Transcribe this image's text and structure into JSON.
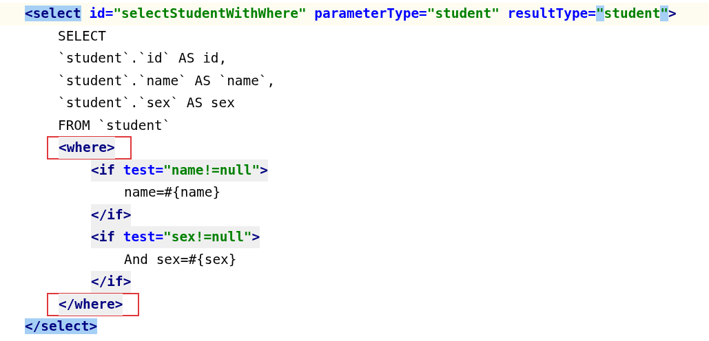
{
  "editor": {
    "lines": [
      {
        "current": true,
        "boxed": false,
        "tag_line": false,
        "tokens": [
          {
            "kind": "tag",
            "text": "<select",
            "highlighted": true
          },
          {
            "kind": "attr",
            "text": " id="
          },
          {
            "kind": "string",
            "text": "\"selectStudentWithWhere\""
          },
          {
            "kind": "attr",
            "text": " parameterType="
          },
          {
            "kind": "string",
            "text": "\"student\""
          },
          {
            "kind": "attr",
            "text": " resultType="
          },
          {
            "kind": "string",
            "text": "\"",
            "highlighted": true
          },
          {
            "kind": "string",
            "text": "student"
          },
          {
            "kind": "string",
            "text": "\"",
            "highlighted": true
          },
          {
            "kind": "tag",
            "text": ">"
          }
        ],
        "children": [
          {
            "current": false,
            "boxed": false,
            "tag_line": false,
            "tokens": [
              {
                "kind": "text",
                "text": "SELECT"
              }
            ]
          },
          {
            "current": false,
            "boxed": false,
            "tag_line": false,
            "tokens": [
              {
                "kind": "text",
                "text": "`student`.`id` AS id,"
              }
            ]
          },
          {
            "current": false,
            "boxed": false,
            "tag_line": false,
            "tokens": [
              {
                "kind": "text",
                "text": "`student`.`name` AS `name`,"
              }
            ]
          },
          {
            "current": false,
            "boxed": false,
            "tag_line": false,
            "tokens": [
              {
                "kind": "text",
                "text": "`student`.`sex` AS sex"
              }
            ]
          },
          {
            "current": false,
            "boxed": false,
            "tag_line": false,
            "tokens": [
              {
                "kind": "text",
                "text": "FROM `student`"
              }
            ]
          },
          {
            "current": false,
            "boxed": true,
            "tag_line": true,
            "tokens": [
              {
                "kind": "tag",
                "text": "<where>"
              }
            ],
            "children": [
              {
                "current": false,
                "boxed": false,
                "tag_line": true,
                "tokens": [
                  {
                    "kind": "tag",
                    "text": "<if"
                  },
                  {
                    "kind": "attr",
                    "text": " test="
                  },
                  {
                    "kind": "string",
                    "text": "\"name!=null\""
                  },
                  {
                    "kind": "tag",
                    "text": ">"
                  }
                ],
                "children": [
                  {
                    "current": false,
                    "boxed": false,
                    "tag_line": false,
                    "tokens": [
                      {
                        "kind": "text",
                        "text": "name=#{name}"
                      }
                    ]
                  }
                ]
              },
              {
                "current": false,
                "boxed": false,
                "tag_line": true,
                "tokens": [
                  {
                    "kind": "tag",
                    "text": "</if>"
                  }
                ]
              },
              {
                "current": false,
                "boxed": false,
                "tag_line": true,
                "tokens": [
                  {
                    "kind": "tag",
                    "text": "<if"
                  },
                  {
                    "kind": "attr",
                    "text": " test="
                  },
                  {
                    "kind": "string",
                    "text": "\"sex!=null\""
                  },
                  {
                    "kind": "tag",
                    "text": ">"
                  }
                ],
                "children": [
                  {
                    "current": false,
                    "boxed": false,
                    "tag_line": false,
                    "tokens": [
                      {
                        "kind": "text",
                        "text": "And sex=#{sex}"
                      }
                    ]
                  }
                ]
              },
              {
                "current": false,
                "boxed": false,
                "tag_line": true,
                "tokens": [
                  {
                    "kind": "tag",
                    "text": "</if>"
                  }
                ]
              }
            ]
          },
          {
            "current": false,
            "boxed": true,
            "tag_line": true,
            "tokens": [
              {
                "kind": "tag",
                "text": "</where>"
              }
            ]
          }
        ]
      },
      {
        "current": false,
        "boxed": false,
        "tag_line": false,
        "tokens": [
          {
            "kind": "tag",
            "text": "</select>",
            "highlighted": true
          }
        ]
      }
    ]
  }
}
